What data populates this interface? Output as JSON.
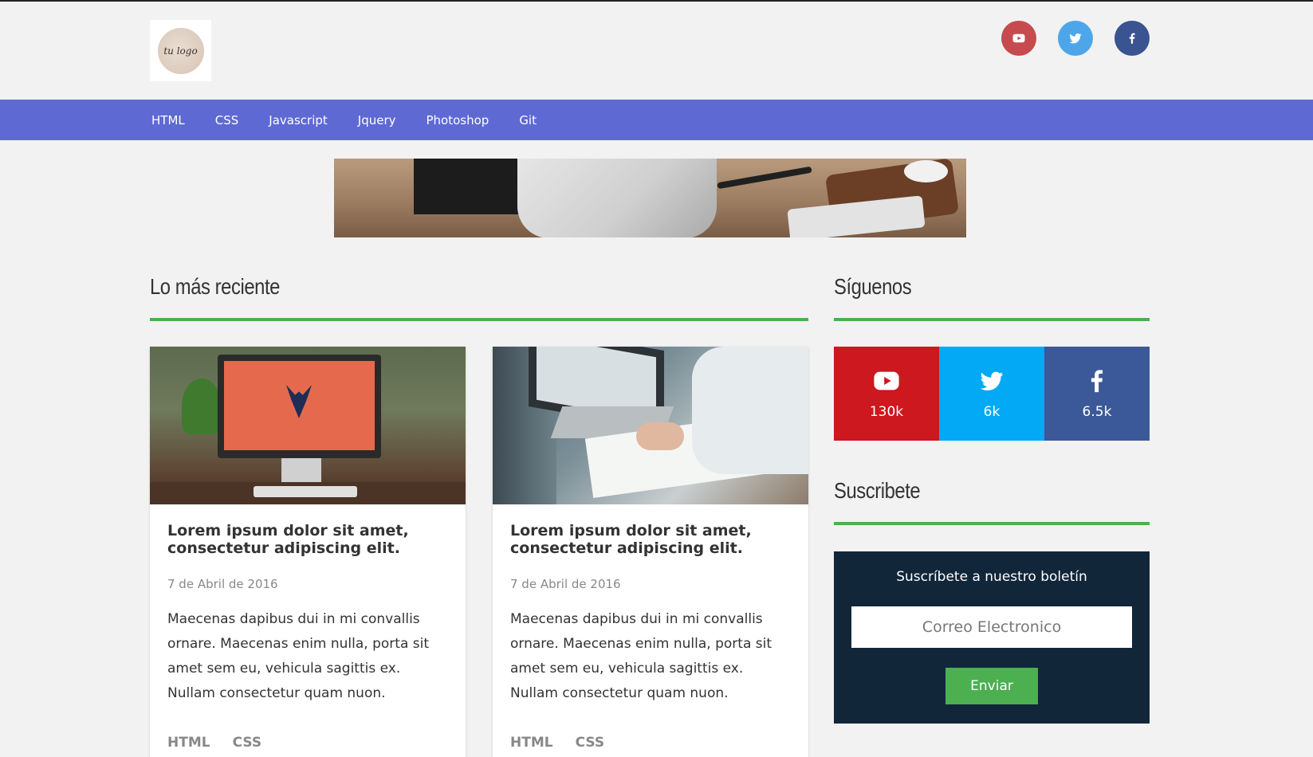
{
  "header": {
    "logo_text": "tu logo",
    "social": [
      {
        "name": "youtube",
        "icon": "youtube-icon",
        "color": "#c54b4f"
      },
      {
        "name": "twitter",
        "icon": "twitter-icon",
        "color": "#4ea6ea"
      },
      {
        "name": "facebook",
        "icon": "facebook-icon",
        "color": "#3a5391"
      }
    ]
  },
  "nav": {
    "items": [
      "HTML",
      "CSS",
      "Javascript",
      "Jquery",
      "Photoshop",
      "Git"
    ],
    "color": "#5f69d4"
  },
  "main": {
    "section_title": "Lo más reciente",
    "cards": [
      {
        "title": "Lorem ipsum dolor sit amet, consectetur adipiscing elit.",
        "date": "7 de Abril de 2016",
        "text": "Maecenas dapibus dui in mi convallis ornare. Maecenas enim nulla, porta sit amet sem eu, vehicula sagittis ex. Nullam consectetur quam nuon.",
        "tags": [
          "HTML",
          "CSS"
        ]
      },
      {
        "title": "Lorem ipsum dolor sit amet, consectetur adipiscing elit.",
        "date": "7 de Abril de 2016",
        "text": "Maecenas dapibus dui in mi convallis ornare. Maecenas enim nulla, porta sit amet sem eu, vehicula sagittis ex. Nullam consectetur quam nuon.",
        "tags": [
          "HTML",
          "CSS"
        ]
      }
    ]
  },
  "sidebar": {
    "follow_title": "Síguenos",
    "follow": [
      {
        "network": "youtube",
        "count": "130k",
        "color": "#cc181e"
      },
      {
        "network": "twitter",
        "count": "6k",
        "color": "#03a9f4"
      },
      {
        "network": "facebook",
        "count": "6.5k",
        "color": "#3b5998"
      }
    ],
    "subscribe_title": "Suscribete",
    "subscribe": {
      "heading": "Suscríbete a nuestro boletín",
      "placeholder": "Correo Electronico",
      "button": "Enviar"
    }
  },
  "accent_color": "#4caf50"
}
